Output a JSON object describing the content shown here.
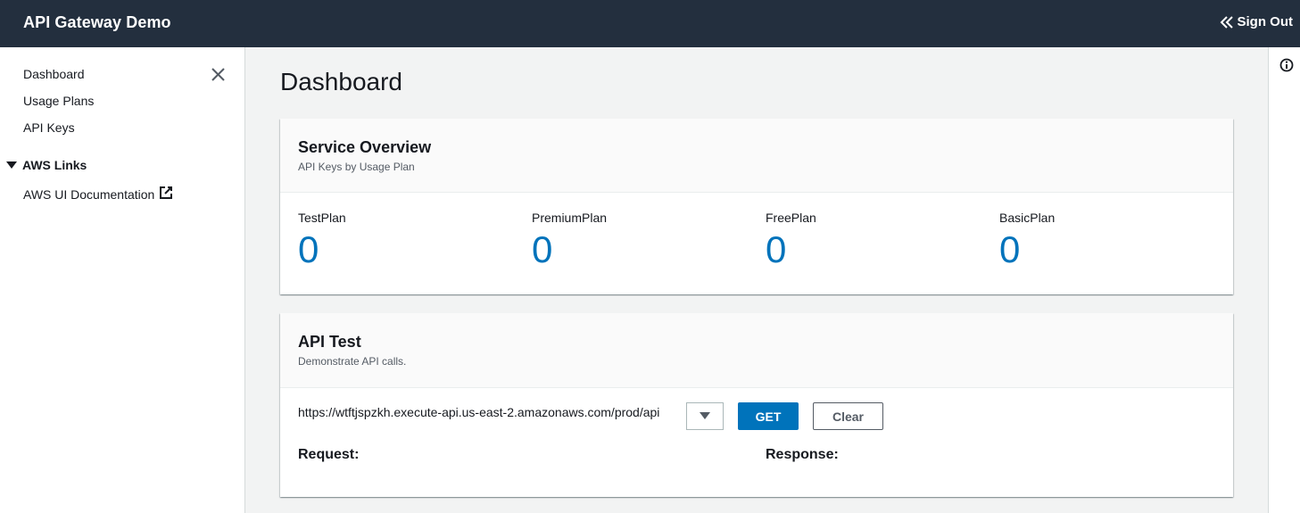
{
  "header": {
    "app_title": "API Gateway Demo",
    "sign_out_label": "Sign Out"
  },
  "sidebar": {
    "items": [
      {
        "label": "Dashboard"
      },
      {
        "label": "Usage Plans"
      },
      {
        "label": "API Keys"
      }
    ],
    "section": {
      "label": "AWS Links",
      "expanded": true,
      "links": [
        {
          "label": "AWS UI Documentation",
          "external": true
        }
      ]
    }
  },
  "main": {
    "page_title": "Dashboard",
    "service_overview": {
      "title": "Service Overview",
      "description": "API Keys by Usage Plan",
      "stats": [
        {
          "label": "TestPlan",
          "value": "0"
        },
        {
          "label": "PremiumPlan",
          "value": "0"
        },
        {
          "label": "FreePlan",
          "value": "0"
        },
        {
          "label": "BasicPlan",
          "value": "0"
        }
      ]
    },
    "api_test": {
      "title": "API Test",
      "description": "Demonstrate API calls.",
      "url": "https://wtftjspzkh.execute-api.us-east-2.amazonaws.com/prod/api",
      "get_label": "GET",
      "clear_label": "Clear",
      "request_label": "Request:",
      "response_label": "Response:"
    }
  },
  "colors": {
    "topbar": "#232f3e",
    "accent": "#0073bb",
    "background": "#f2f3f3"
  }
}
